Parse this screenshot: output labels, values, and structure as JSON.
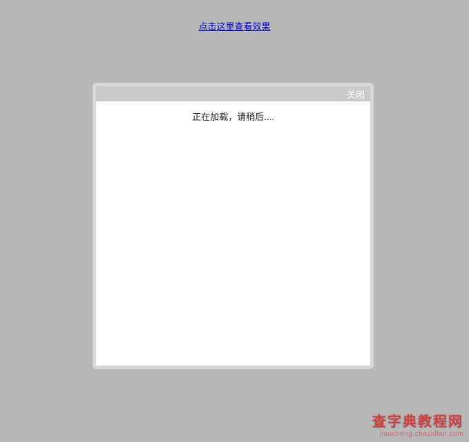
{
  "topLink": {
    "label": "点击这里查看效果"
  },
  "modal": {
    "closeLabel": "关闭",
    "loadingText": "正在加载，请稍后...."
  },
  "watermark": {
    "main": "查字典教程网",
    "sub": "jiaocheng.chazidian.com"
  }
}
